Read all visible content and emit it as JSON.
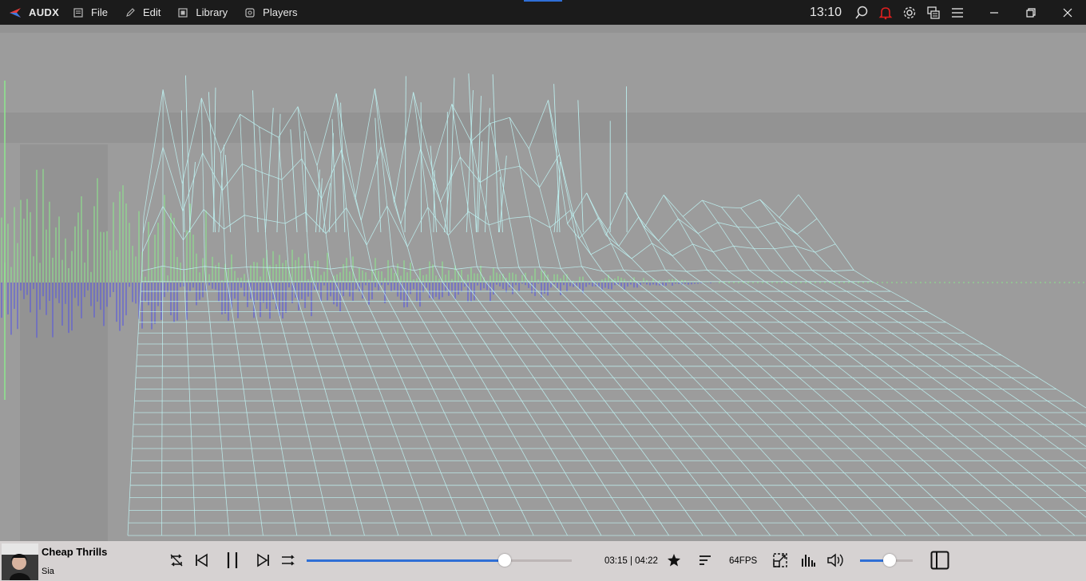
{
  "app": {
    "name": "AUDX"
  },
  "menu": [
    {
      "label": "File",
      "icon": "file-icon"
    },
    {
      "label": "Edit",
      "icon": "pencil-icon"
    },
    {
      "label": "Library",
      "icon": "library-icon"
    },
    {
      "label": "Players",
      "icon": "players-icon"
    }
  ],
  "clock": "13:10",
  "colors": {
    "accent": "#2f6fd6",
    "wave_green": "#8fe48f",
    "wave_blue": "#5a5adf",
    "mesh": "#bff4f4",
    "notification": "#e02020"
  },
  "now_playing": {
    "title": "Cheap Thrills",
    "artist": "Sia"
  },
  "playback": {
    "time_display": "03:15 | 04:22",
    "progress": 0.746,
    "volume": 0.56,
    "fps": "64FPS"
  },
  "icons": {
    "titlebar": [
      "search-icon",
      "bell-icon",
      "gear-icon",
      "layout-icon",
      "hamburger-menu-icon"
    ],
    "controls": [
      "repeat-icon",
      "previous-icon",
      "pause-icon",
      "next-icon",
      "shuffle-icon"
    ],
    "tools": [
      "star-icon",
      "sort-icon",
      "resize-icon",
      "equalizer-icon",
      "speaker-icon",
      "sidebar-panel-icon"
    ]
  }
}
